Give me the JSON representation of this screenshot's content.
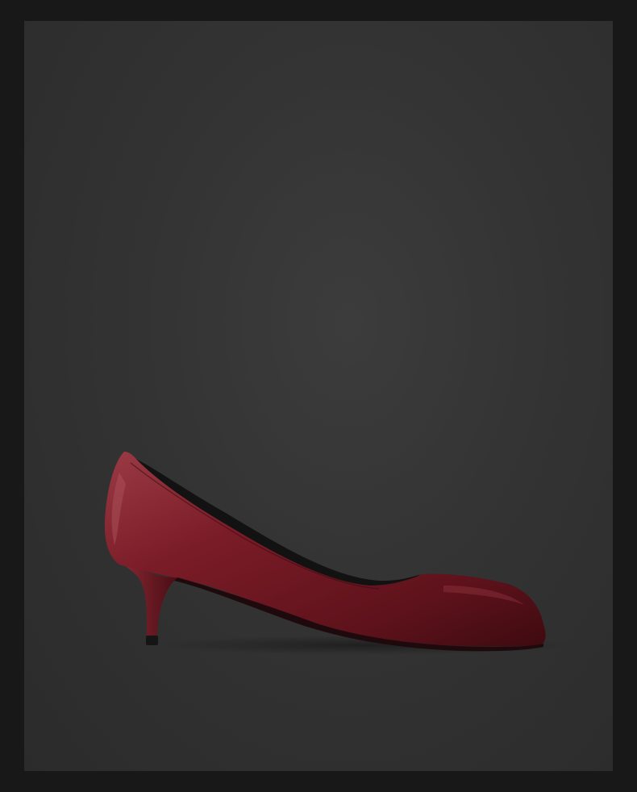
{
  "scene": {
    "subject_icon": "pump-shoe-icon",
    "colors": {
      "frame": "#181818",
      "backdrop": "#343434",
      "shoe_main": "#6e1620",
      "shoe_highlight": "#9a3a44",
      "shoe_shadow": "#3e0a10",
      "lining": "#121212"
    }
  }
}
